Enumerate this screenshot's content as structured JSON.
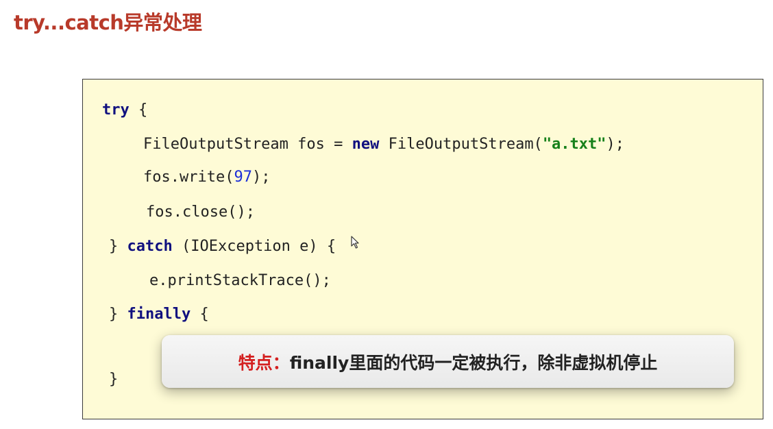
{
  "title": "try...catch异常处理",
  "code": {
    "line1": {
      "kw": "try",
      "rest": " {"
    },
    "line2": {
      "a": "FileOutputStream fos = ",
      "kw": "new",
      "b": " FileOutputStream(",
      "str": "\"a.txt\"",
      "c": ");"
    },
    "line3": {
      "a": "fos.write(",
      "num": "97",
      "b": ");"
    },
    "line4": {
      "text": "fos.close();"
    },
    "line5": {
      "a": "} ",
      "kw": "catch",
      "b": " (IOException e) {"
    },
    "line6": {
      "text": "e.printStackTrace();"
    },
    "line7": {
      "a": "} ",
      "kw": "finally",
      "b": " {"
    },
    "line8": {
      "text": "}"
    }
  },
  "tooltip": {
    "label": "特点：",
    "text": "finally里面的代码一定被执行，除非虚拟机停止"
  },
  "colors": {
    "title": "#b83a2a",
    "code_background": "#fefbd6",
    "keyword": "#10107f",
    "string": "#16801a",
    "number": "#1c2fd8",
    "tooltip_label": "#d42020"
  }
}
